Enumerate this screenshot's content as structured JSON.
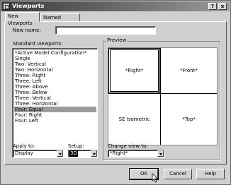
{
  "window": {
    "title": "Viewports",
    "help_glyph": "?",
    "close_glyph": "x"
  },
  "tabs": [
    {
      "label": "New Viewports"
    },
    {
      "label": "Named Viewports"
    }
  ],
  "new_name": {
    "label": "New name:",
    "value": ""
  },
  "standard_viewports": {
    "label": "Standard viewports:",
    "items": [
      "*Active Model Configuration*",
      "Single",
      "Two:  Vertical",
      "Two:  Horizontal",
      "Three: Right",
      "Three: Left",
      "Three: Above",
      "Three: Below",
      "Three: Vertical",
      "Three: Horizontal",
      "Four: Equal",
      "Four: Right",
      "Four: Left"
    ],
    "selected": "Four: Equal"
  },
  "preview": {
    "label": "Preview",
    "viewports": [
      "*Right*",
      "*Front*",
      "SE Isometric",
      "*Top*"
    ]
  },
  "apply_to": {
    "label": "Apply to:",
    "value": "Display"
  },
  "setup": {
    "label": "Setup:",
    "value": "3D"
  },
  "change_view": {
    "label": "Change view to:",
    "value": "*Right*"
  },
  "buttons": {
    "ok": "OK",
    "cancel": "Cancel",
    "help": "Help"
  }
}
